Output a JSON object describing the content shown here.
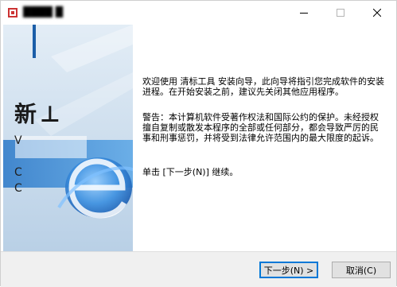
{
  "window": {
    "title": "████ █",
    "controls": {
      "minimize_icon": "minimize-icon",
      "maximize_icon": "maximize-icon",
      "close_icon": "close-icon"
    }
  },
  "banner": {
    "heading": "新",
    "letters": [
      "V",
      "C",
      "C"
    ],
    "logo_icon": "e-logo-icon"
  },
  "content": {
    "welcome": "欢迎使用 清标工具 安装向导，此向导将指引您完成软件的安装进程。在开始安装之前，建议先关闭其他应用程序。",
    "warning": "警告：本计算机软件受著作权法和国际公约的保护。未经授权擅自复制或散发本程序的全部或任何部分，都会导致严厉的民事和刑事惩罚，并将受到法律允许范围内的最大限度的起诉。",
    "instruction": "单击 [下一步(N)] 继续。"
  },
  "footer": {
    "next_label": "下一步(N) >",
    "cancel_label": "取消(C)"
  },
  "colors": {
    "accent": "#0078d7",
    "banner_blue": "#1b5ea8",
    "footer_bg": "#f0f0f0"
  }
}
